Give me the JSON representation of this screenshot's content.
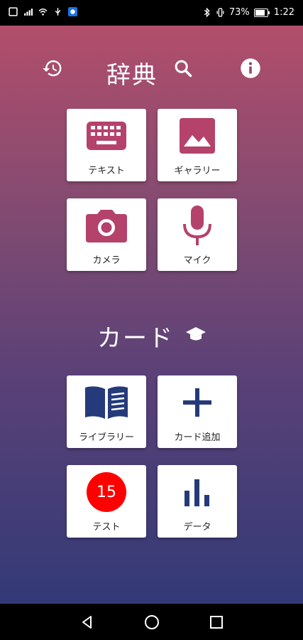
{
  "status_bar": {
    "battery_percent": "73%",
    "time": "1:22"
  },
  "header": {
    "title": "辞典"
  },
  "dictionary_tiles": [
    {
      "label": "テキスト",
      "icon": "keyboard-icon"
    },
    {
      "label": "ギャラリー",
      "icon": "image-icon"
    },
    {
      "label": "カメラ",
      "icon": "camera-icon"
    },
    {
      "label": "マイク",
      "icon": "microphone-icon"
    }
  ],
  "cards_section": {
    "title": "カード"
  },
  "card_tiles": [
    {
      "label": "ライブラリー",
      "icon": "book-icon"
    },
    {
      "label": "カード追加",
      "icon": "plus-icon"
    },
    {
      "label": "テスト",
      "icon": "badge",
      "badge_count": "15"
    },
    {
      "label": "データ",
      "icon": "bar-chart-icon"
    }
  ],
  "colors": {
    "tile_icon_red": "#b5426a",
    "tile_icon_navy": "#243a7a",
    "badge_red": "#ff0000"
  }
}
